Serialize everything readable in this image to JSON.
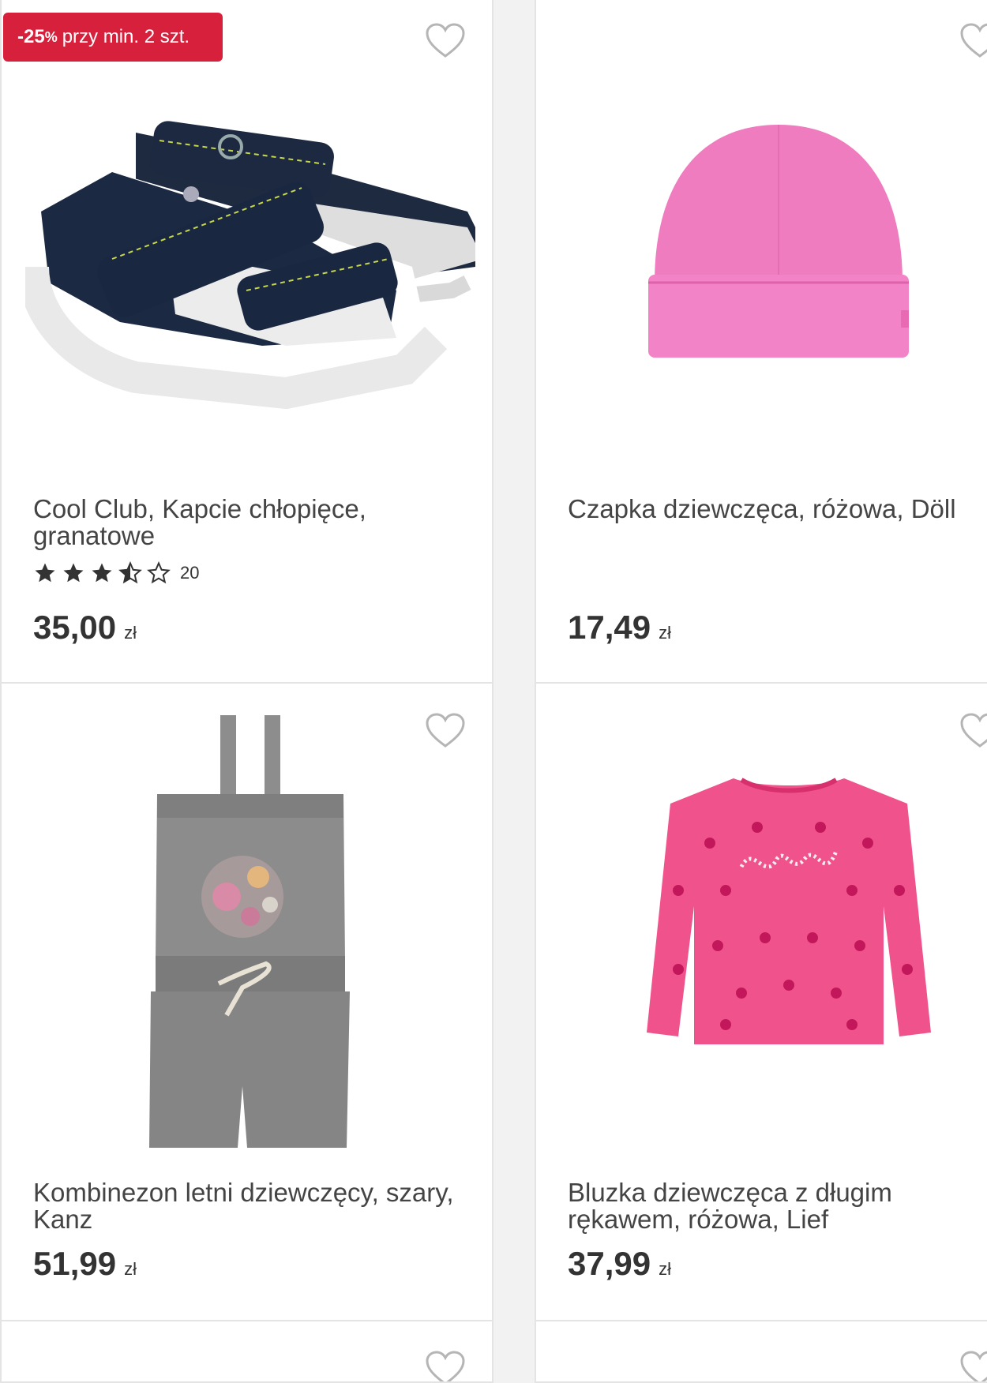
{
  "colors": {
    "badge": "#d7203b",
    "accent": "#d7203b"
  },
  "products": [
    {
      "badge": {
        "value": "-25",
        "pct": "%",
        "text": "przy min. 2 szt."
      },
      "title": "Cool Club, Kapcie chłopięce, granatowe",
      "rating_value": 3.5,
      "rating_count": "20",
      "price": "35,00",
      "currency": "zł",
      "image_icon": "sandals-image"
    },
    {
      "title": "Czapka dziewczęca, różowa, Döll",
      "price": "17,49",
      "currency": "zł",
      "image_icon": "pink-hat-image"
    },
    {
      "title": "Kombinezon letni dziewczęcy, szary, Kanz",
      "price": "51,99",
      "currency": "zł",
      "image_icon": "grey-jumpsuit-image"
    },
    {
      "title": "Bluzka dziewczęca z długim rękawem, różowa, Lief",
      "price": "37,99",
      "currency": "zł",
      "image_icon": "pink-blouse-image"
    }
  ]
}
